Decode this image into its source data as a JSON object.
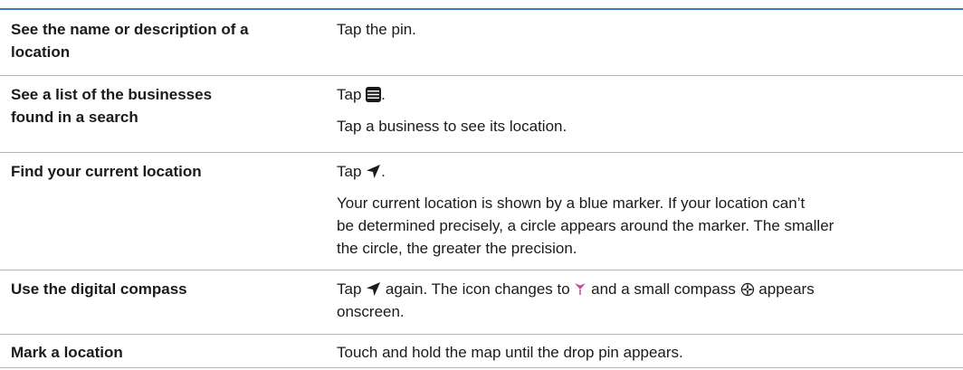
{
  "colors": {
    "rule_blue": "#3a7bbf",
    "rule_gray": "#b3b3b3",
    "icon_dark": "#1a1a1a",
    "compass_pink": "#c7469e"
  },
  "rows": [
    {
      "title_lines": [
        "See the name or description of a",
        "location"
      ],
      "desc_lines": [
        "Tap the pin."
      ]
    },
    {
      "title_lines": [
        "See a list of the businesses",
        "found in a search"
      ],
      "desc_parts": {
        "pre": "Tap ",
        "icon": "list-icon",
        "post": "."
      },
      "desc_lines": [
        "Tap a business to see its location."
      ]
    },
    {
      "title_lines": [
        "Find your current location"
      ],
      "desc_parts": {
        "pre": "Tap ",
        "icon": "location-arrow-icon",
        "post": "."
      },
      "desc_lines": [
        "Your current location is shown by a blue marker. If your location can’t",
        "be determined precisely, a circle appears around the marker. The smaller",
        "the circle, the greater the precision."
      ]
    },
    {
      "title_lines": [
        "Use the digital compass"
      ],
      "desc_parts": {
        "pre": "Tap ",
        "icon": "location-arrow-icon",
        "mid": " again. The icon changes to ",
        "icon2": "compass-heading-icon",
        "mid2": " and a small compass ",
        "icon3": "compass-rose-icon",
        "post": " appears"
      },
      "desc_lines": [
        "onscreen."
      ]
    },
    {
      "title_lines": [
        "Mark a location"
      ],
      "desc_lines": [
        "Touch and hold the map until the drop pin appears."
      ]
    }
  ]
}
